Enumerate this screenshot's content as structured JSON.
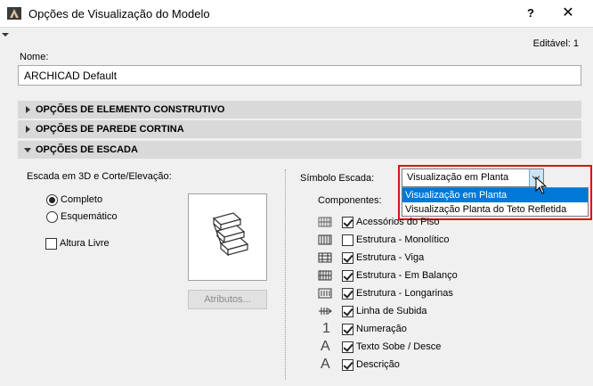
{
  "window": {
    "title": "Opções de Visualização do Modelo",
    "help_label": "?",
    "close_label": "✕"
  },
  "editable": "Editável: 1",
  "name_field": {
    "label": "Nome:",
    "value": "ARCHICAD Default"
  },
  "sections": [
    {
      "label": "OPÇÕES DE ELEMENTO CONSTRUTIVO",
      "expanded": false
    },
    {
      "label": "OPÇÕES DE PAREDE CORTINA",
      "expanded": false
    },
    {
      "label": "OPÇÕES DE ESCADA",
      "expanded": true
    }
  ],
  "stair": {
    "view_label": "Escada em 3D e Corte/Elevação:",
    "options": [
      {
        "label": "Completo",
        "selected": true
      },
      {
        "label": "Esquemático",
        "selected": false
      }
    ],
    "headroom": {
      "label": "Altura Livre",
      "checked": false
    },
    "attributes_button": "Atributos...",
    "symbol_label": "Símbolo Escada:",
    "symbol_value": "Visualização em Planta",
    "symbol_options": [
      "Visualização em Planta",
      "Visualização Planta do Teto Refletida"
    ],
    "components_label": "Componentes:",
    "components": [
      {
        "label": "Acessórios do Piso",
        "checked": true,
        "icon": "floor-accessories-icon"
      },
      {
        "label": "Estrutura - Monolítico",
        "checked": false,
        "icon": "monolithic-structure-icon"
      },
      {
        "label": "Estrutura - Viga",
        "checked": true,
        "icon": "beam-structure-icon"
      },
      {
        "label": "Estrutura - Em Balanço",
        "checked": true,
        "icon": "cantilever-structure-icon"
      },
      {
        "label": "Estrutura - Longarinas",
        "checked": true,
        "icon": "stringer-structure-icon"
      },
      {
        "label": "Linha de Subida",
        "checked": true,
        "icon": "walking-line-icon"
      },
      {
        "label": "Numeração",
        "checked": true,
        "icon": "numbering-icon",
        "glyph": "1"
      },
      {
        "label": "Texto Sobe / Desce",
        "checked": true,
        "icon": "up-down-text-icon",
        "glyph": "A"
      },
      {
        "label": "Descrição",
        "checked": true,
        "icon": "description-icon",
        "glyph": "A"
      }
    ]
  },
  "colors": {
    "highlight_border": "#e01010",
    "selection": "#0078d7",
    "section_bg": "#d9d9d9"
  }
}
